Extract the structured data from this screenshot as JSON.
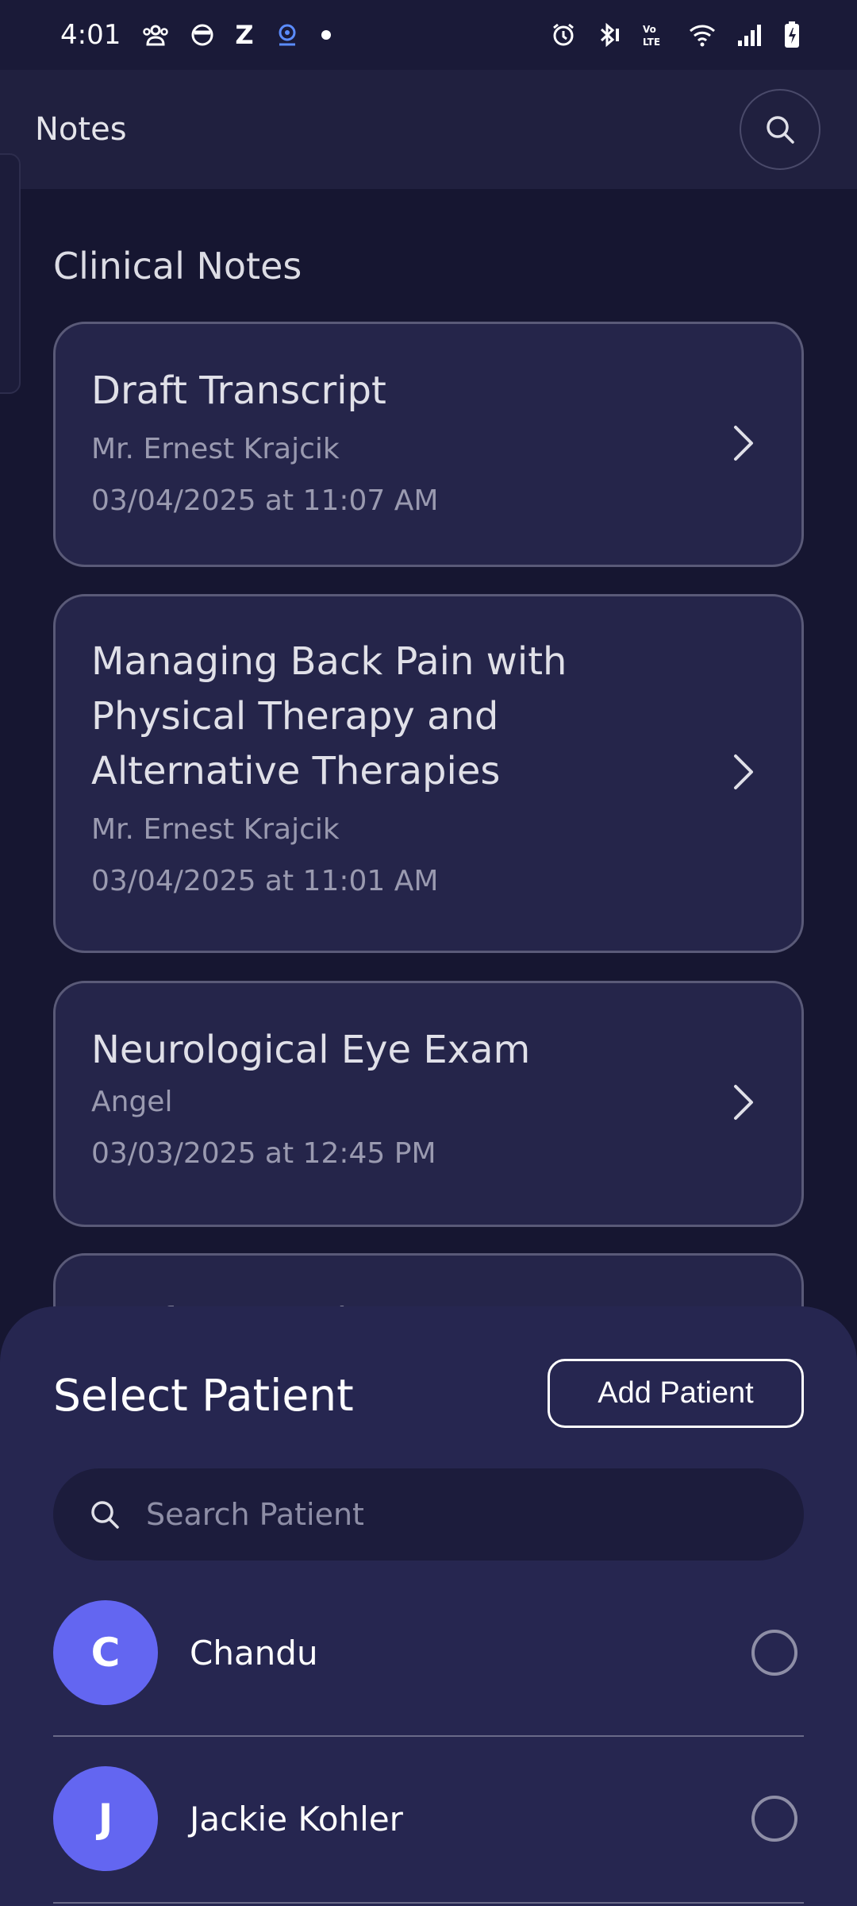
{
  "status_bar": {
    "time": "4:01",
    "left_icons": [
      "people-icon",
      "face-icon",
      "z-icon",
      "camera-icon",
      "dot-icon"
    ],
    "z_label": "Z",
    "right_icons": [
      "alarm-icon",
      "bluetooth-icon",
      "volte-icon",
      "wifi-icon",
      "signal-icon",
      "battery-icon"
    ]
  },
  "app_bar": {
    "title": "Notes",
    "search_icon": "search-icon"
  },
  "section": {
    "title": "Clinical Notes"
  },
  "notes": [
    {
      "title": "Draft Transcript",
      "patient": "Mr. Ernest Krajcik",
      "datetime": "03/04/2025 at 11:07 AM"
    },
    {
      "title": "Managing Back Pain with Physical Therapy and Alternative Therapies",
      "patient": "Mr. Ernest Krajcik",
      "datetime": "03/04/2025 at 11:01 AM"
    },
    {
      "title": "Neurological Eye Exam",
      "patient": "Angel",
      "datetime": "03/03/2025 at 12:45 PM"
    },
    {
      "title": "Draft Transcript"
    }
  ],
  "sheet": {
    "title": "Select Patient",
    "add_button": "Add Patient",
    "search_placeholder": "Search Patient",
    "patients": [
      {
        "initial": "C",
        "name": "Chandu",
        "selected": false
      },
      {
        "initial": "J",
        "name": "Jackie Kohler",
        "selected": false
      }
    ]
  },
  "colors": {
    "background": "#161631",
    "card": "#25254a",
    "sheet": "#262650",
    "avatar": "#6366f1",
    "text_muted": "#9a9ab0"
  }
}
